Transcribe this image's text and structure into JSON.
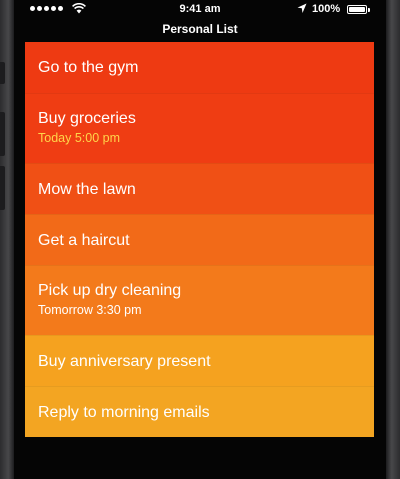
{
  "status_bar": {
    "time": "9:41 am",
    "battery_percent": "100%",
    "battery_level": 1.0
  },
  "header": {
    "title": "Personal List"
  },
  "tasks": [
    {
      "label": "Go to the gym",
      "reminder": "",
      "color": "#ee3a12",
      "reminder_color": "#ffffff"
    },
    {
      "label": "Buy groceries",
      "reminder": "Today 5:00 pm",
      "color": "#ef3d13",
      "reminder_color": "#ffd54a"
    },
    {
      "label": "Mow the lawn",
      "reminder": "",
      "color": "#f05015",
      "reminder_color": "#ffffff"
    },
    {
      "label": "Get a haircut",
      "reminder": "",
      "color": "#f26a18",
      "reminder_color": "#ffffff"
    },
    {
      "label": "Pick up dry cleaning",
      "reminder": "Tomorrow 3:30 pm",
      "color": "#f37a1b",
      "reminder_color": "#ffffff"
    },
    {
      "label": "Buy anniversary present",
      "reminder": "",
      "color": "#f5a21f",
      "reminder_color": "#ffffff"
    },
    {
      "label": "Reply to morning emails",
      "reminder": "",
      "color": "#f3a522",
      "reminder_color": "#ffffff"
    }
  ],
  "icons": {
    "signal": "signal-dots-icon",
    "wifi": "wifi-icon",
    "location": "location-arrow-icon",
    "battery": "battery-icon"
  }
}
